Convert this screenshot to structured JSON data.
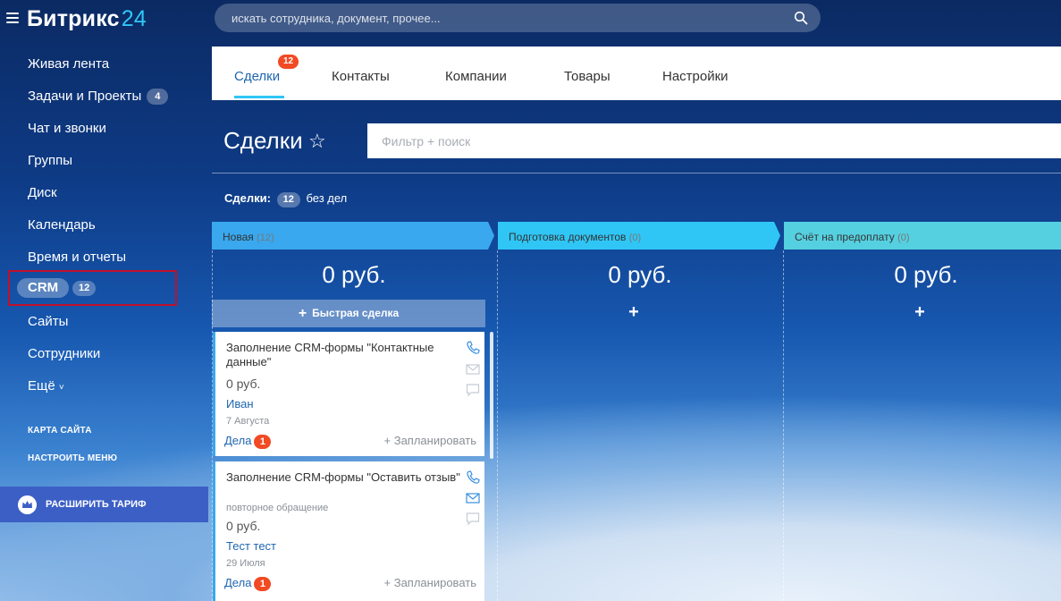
{
  "app": {
    "logo_text": "Битрикс",
    "logo_number": "24"
  },
  "search": {
    "placeholder": "искать сотрудника, документ, прочее..."
  },
  "sidebar": {
    "items": [
      {
        "label": "Живая лента"
      },
      {
        "label": "Задачи и Проекты",
        "badge": "4"
      },
      {
        "label": "Чат и звонки"
      },
      {
        "label": "Группы"
      },
      {
        "label": "Диск"
      },
      {
        "label": "Календарь"
      },
      {
        "label": "Время и отчеты"
      },
      {
        "label": "CRM",
        "badge": "12"
      },
      {
        "label": "Сайты"
      },
      {
        "label": "Сотрудники"
      },
      {
        "label": "Ещё"
      }
    ],
    "more_arrow": "˅",
    "sitemap": "КАРТА САЙТА",
    "configure_menu": "НАСТРОИТЬ МЕНЮ",
    "upgrade": "РАСШИРИТЬ ТАРИФ"
  },
  "tabs": [
    {
      "label": "Сделки",
      "counter": "12"
    },
    {
      "label": "Контакты"
    },
    {
      "label": "Компании"
    },
    {
      "label": "Товары"
    },
    {
      "label": "Настройки"
    }
  ],
  "page": {
    "title": "Сделки",
    "star": "☆",
    "filter_placeholder": "Фильтр + поиск",
    "summary_label": "Сделки:",
    "summary_count": "12",
    "summary_text": "без дел"
  },
  "colors": {
    "accent": "#2fc6f6",
    "link": "#2067b0",
    "badge_red": "#f14a24",
    "col1": "#39a8ef",
    "col2": "#2fc6f6",
    "col3": "#55d0e0"
  },
  "columns": [
    {
      "name": "Новая",
      "count": "(12)",
      "sum": "0 руб.",
      "color": "#39a8ef"
    },
    {
      "name": "Подготовка документов",
      "count": "(0)",
      "sum": "0 руб.",
      "color": "#2fc6f6",
      "add": "+"
    },
    {
      "name": "Счёт на предоплату",
      "count": "(0)",
      "sum": "0 руб.",
      "color": "#55d0e0",
      "add": "+"
    }
  ],
  "quick_deal": {
    "plus": "+",
    "label": "Быстрая сделка"
  },
  "cards": [
    {
      "title": "Заполнение CRM-формы \"Контактные данные\"",
      "subtitle": "",
      "price": "0 руб.",
      "contact": "Иван",
      "date": "7 Августа",
      "dela_label": "Дела",
      "dela_count": "1",
      "plan": "+ Запланировать"
    },
    {
      "title": "Заполнение CRM-формы \"Оставить отзыв\"",
      "subtitle": "повторное обращение",
      "price": "0 руб.",
      "contact": "Тест тест",
      "date": "29 Июля",
      "dela_label": "Дела",
      "dela_count": "1",
      "plan": "+ Запланировать"
    }
  ]
}
